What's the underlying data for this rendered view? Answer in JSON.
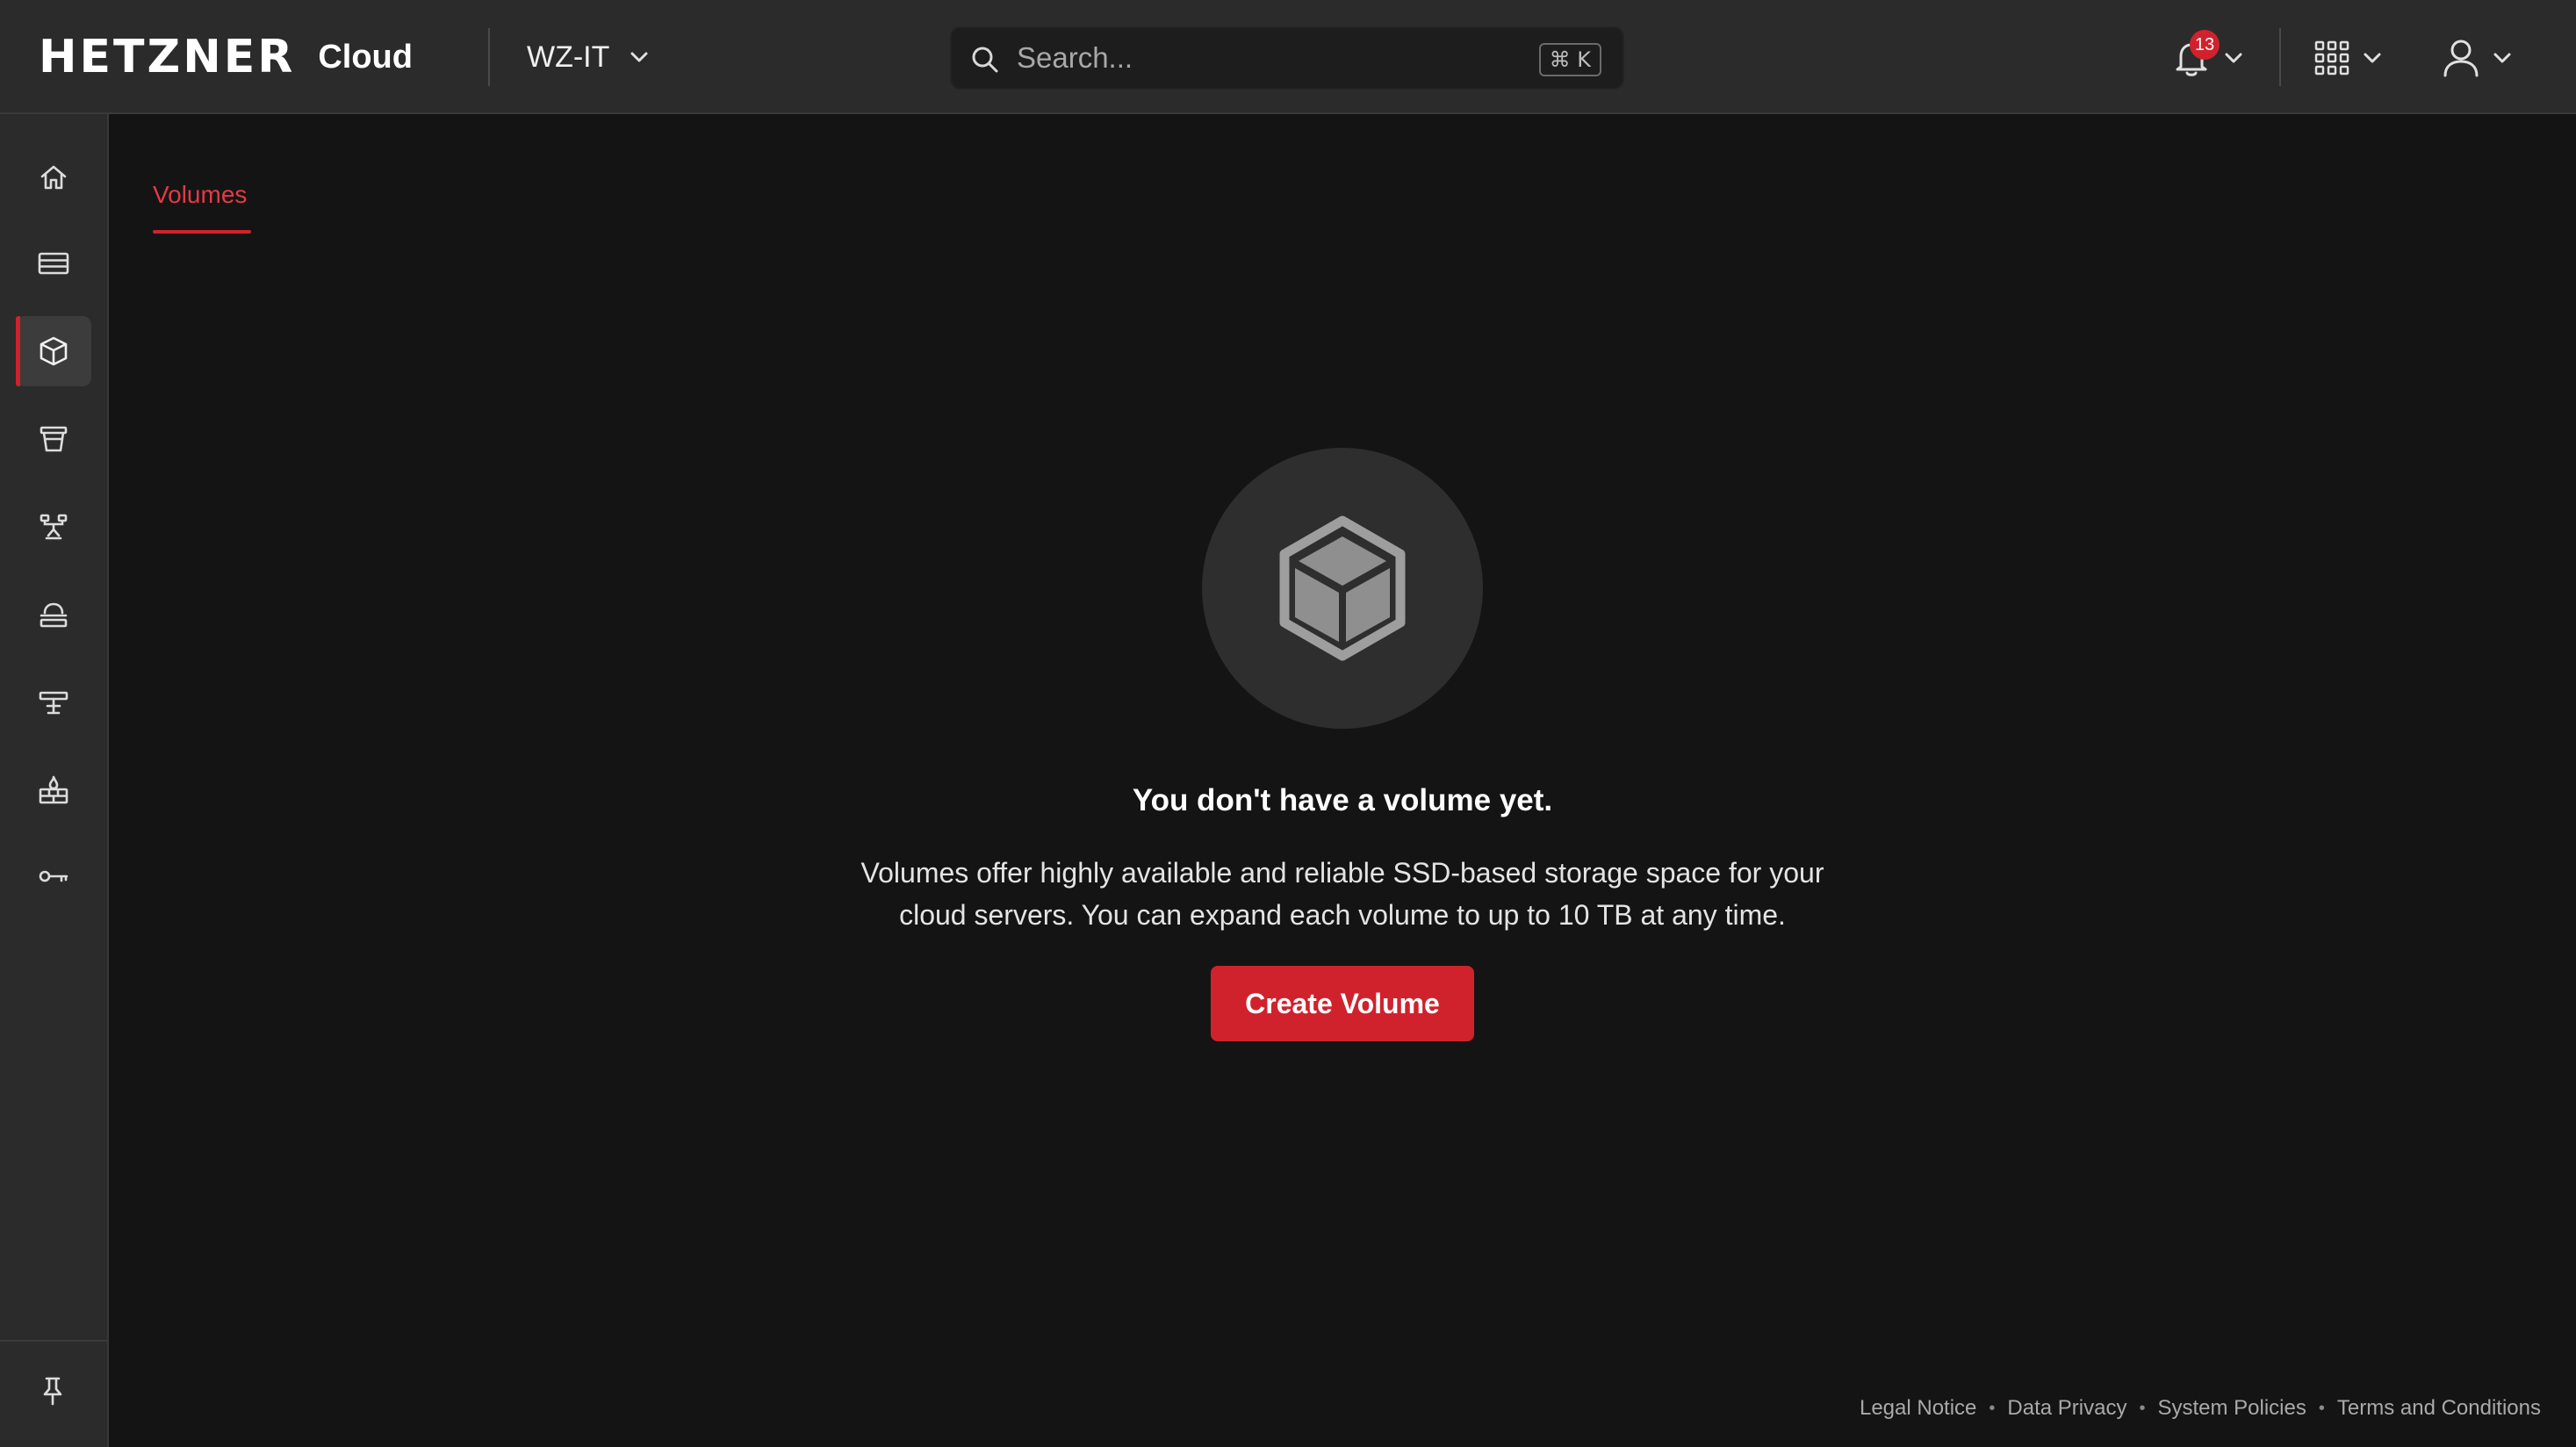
{
  "brand": {
    "logo": "HETZNER",
    "product": "Cloud"
  },
  "project": {
    "name": "WZ-IT"
  },
  "search": {
    "placeholder": "Search...",
    "shortcut": "⌘ K"
  },
  "notifications": {
    "count": "13"
  },
  "sidebar": {
    "items": [
      {
        "name": "home",
        "icon": "home-icon",
        "active": false
      },
      {
        "name": "servers",
        "icon": "server-icon",
        "active": false
      },
      {
        "name": "volumes",
        "icon": "cube-icon",
        "active": true
      },
      {
        "name": "object-storage",
        "icon": "bucket-icon",
        "active": false
      },
      {
        "name": "networks",
        "icon": "network-icon",
        "active": false
      },
      {
        "name": "load-balancers",
        "icon": "load-balancer-icon",
        "active": false
      },
      {
        "name": "floating-ips",
        "icon": "floating-ip-icon",
        "active": false
      },
      {
        "name": "firewalls",
        "icon": "firewall-icon",
        "active": false
      },
      {
        "name": "security",
        "icon": "key-icon",
        "active": false
      }
    ],
    "pin_icon": "pin-icon"
  },
  "tabs": [
    {
      "label": "Volumes",
      "active": true
    }
  ],
  "empty_state": {
    "title": "You don't have a volume yet.",
    "description_line1": "Volumes offer highly available and reliable SSD-based storage space for your",
    "description_line2": "cloud servers. You can expand each volume to up to 10 TB at any time.",
    "button_label": "Create Volume"
  },
  "footer": {
    "links": [
      "Legal Notice",
      "Data Privacy",
      "System Policies",
      "Terms and Conditions"
    ],
    "separator": "•"
  },
  "colors": {
    "accent": "#d0222d",
    "topbar_bg": "#2b2b2b",
    "page_bg": "#141414",
    "sidebar_bg": "#2b2b2b"
  }
}
